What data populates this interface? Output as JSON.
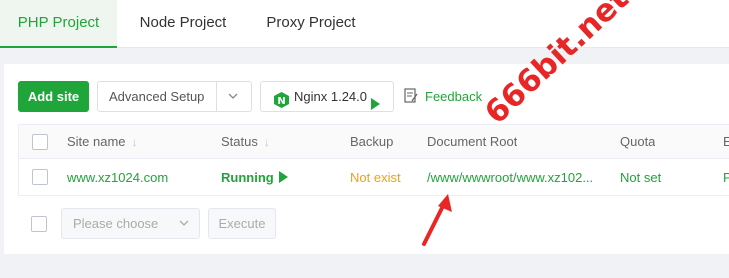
{
  "tabs": [
    {
      "label": "PHP Project",
      "active": true
    },
    {
      "label": "Node Project",
      "active": false
    },
    {
      "label": "Proxy Project",
      "active": false
    }
  ],
  "toolbar": {
    "add_site_label": "Add site",
    "advanced_setup_label": "Advanced Setup",
    "nginx_label": "Nginx 1.24.0",
    "feedback_label": "Feedback"
  },
  "table": {
    "columns": [
      "Site name",
      "Status",
      "Backup",
      "Document Root",
      "Quota",
      "E"
    ],
    "rows": [
      {
        "site_name": "www.xz1024.com",
        "status": "Running",
        "backup": "Not exist",
        "document_root": "/www/wwwroot/www.xz102...",
        "quota": "Not set",
        "extra": "P"
      }
    ]
  },
  "batch": {
    "select_placeholder": "Please choose",
    "execute_label": "Execute"
  },
  "watermark": "666bit.net",
  "colors": {
    "accent": "#20a53a",
    "warning": "#f0a020",
    "annotation": "#e82626"
  }
}
